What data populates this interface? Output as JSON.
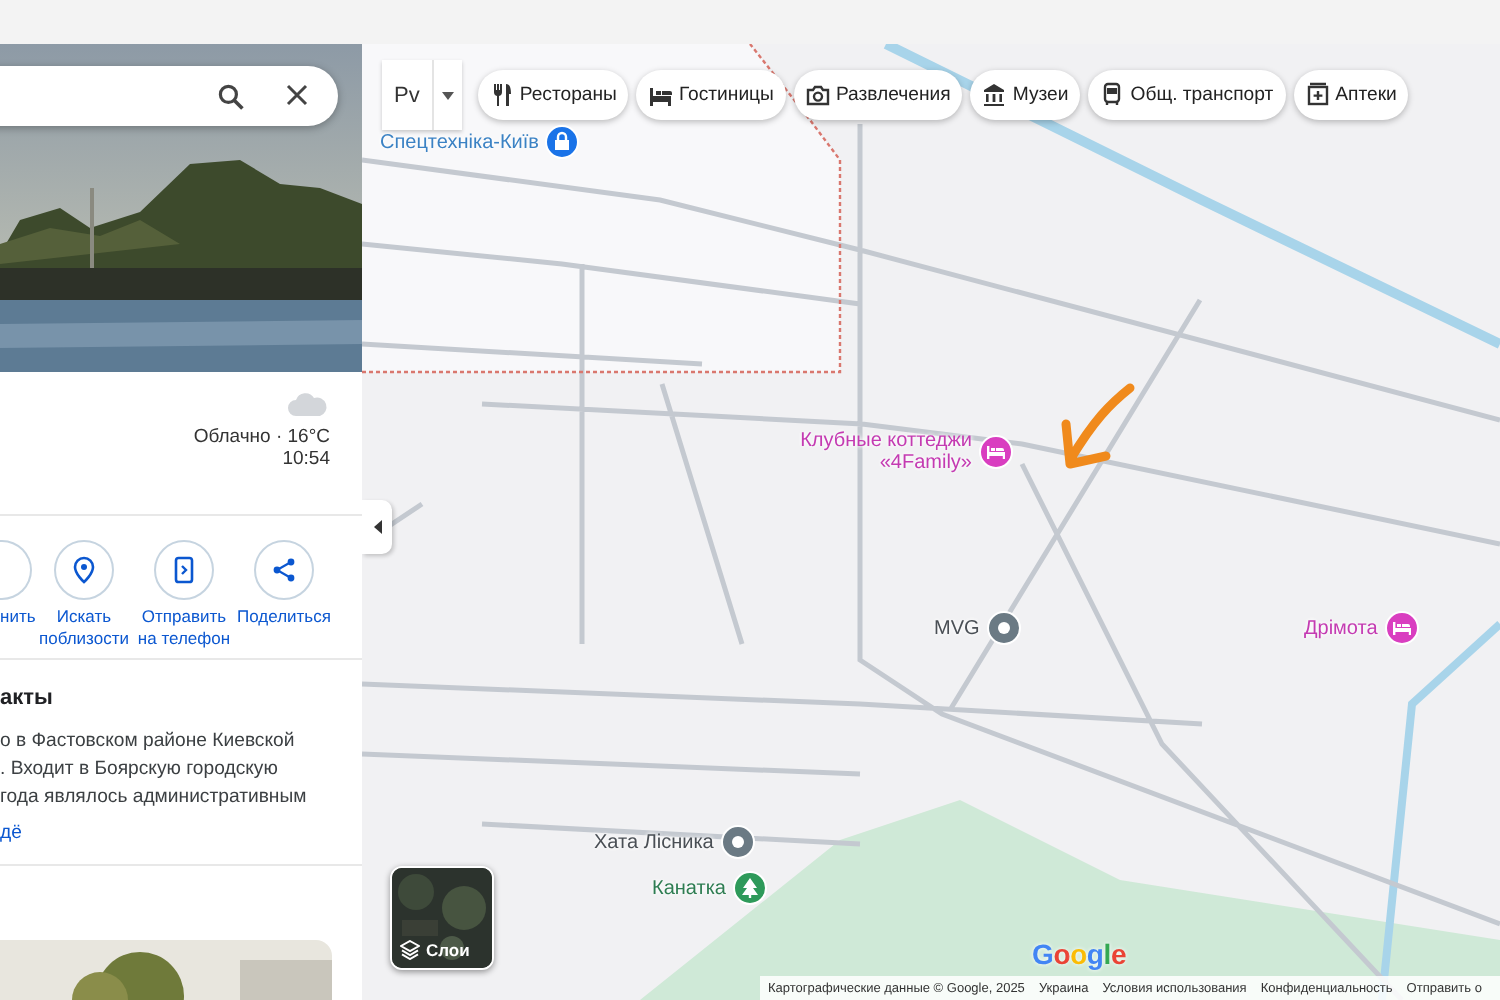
{
  "panel": {
    "weather": {
      "condition": "Облачно · 16°C",
      "time": "10:54"
    },
    "actions": [
      {
        "label": "нить",
        "kind": "save"
      },
      {
        "label": "Искать поблизости",
        "kind": "nearby"
      },
      {
        "label": "Отправить на телефон",
        "kind": "send"
      },
      {
        "label": "Поделиться",
        "kind": "share"
      }
    ],
    "about": {
      "heading": "акты",
      "lines": [
        "о в Фастовском районе Киевской",
        ". Входит в Боярскую городскую",
        " года являлось административным"
      ],
      "more_link": "дё"
    }
  },
  "map": {
    "layer_selector": {
      "value": "Рv"
    },
    "chips": [
      {
        "label": "Рестораны",
        "kind": "restaurant"
      },
      {
        "label": "Гостиницы",
        "kind": "hotel"
      },
      {
        "label": "Развлечения",
        "kind": "camera"
      },
      {
        "label": "Музеи",
        "kind": "museum"
      },
      {
        "label": "Общ. транспорт",
        "kind": "transit"
      },
      {
        "label": "Аптеки",
        "kind": "pharmacy"
      }
    ],
    "places": [
      {
        "name": "Спецтехніка-Київ",
        "kind": "service"
      },
      {
        "name": "Клубные коттеджи «4Family»",
        "kind": "hotel"
      },
      {
        "name": "MVG",
        "kind": "place"
      },
      {
        "name": "Дрімота",
        "kind": "hotel"
      },
      {
        "name": "Хата Лісника",
        "kind": "place"
      },
      {
        "name": "Канатка",
        "kind": "park"
      }
    ],
    "layers_button": {
      "label": "Слои"
    },
    "logo": "Google",
    "footer": [
      "Картографические данные © Google, 2025",
      "Украина",
      "Условия использования",
      "Конфиденциальность",
      "Отправить о"
    ]
  }
}
